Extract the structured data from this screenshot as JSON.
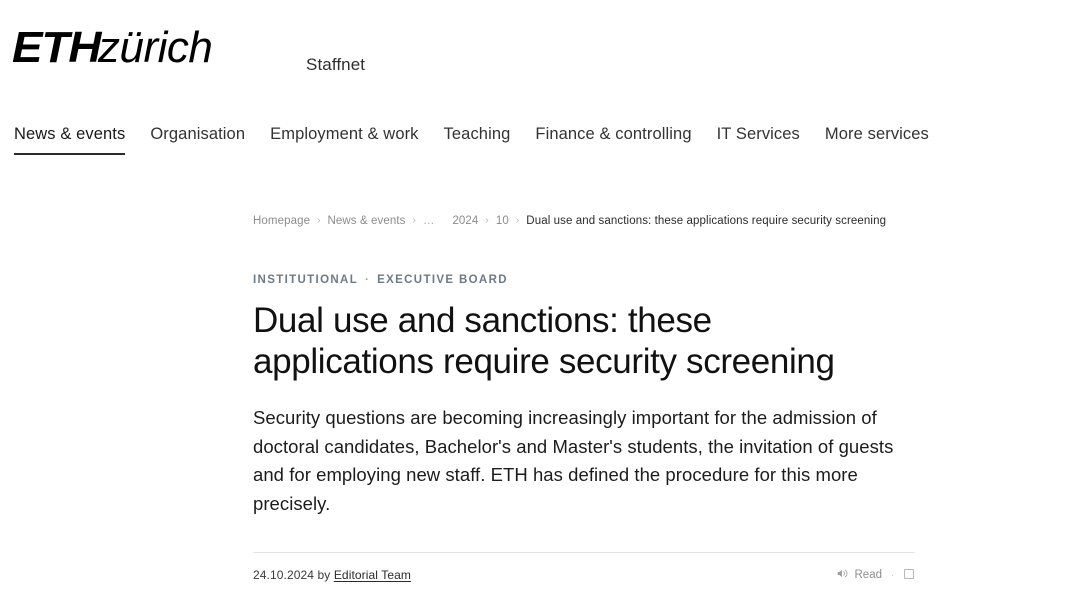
{
  "header": {
    "logo_eth": "ETH",
    "logo_zurich": "zürich",
    "portal_label": "Staffnet"
  },
  "mainnav": {
    "items": [
      {
        "label": "News & events",
        "active": true
      },
      {
        "label": "Organisation",
        "active": false
      },
      {
        "label": "Employment & work",
        "active": false
      },
      {
        "label": "Teaching",
        "active": false
      },
      {
        "label": "Finance & controlling",
        "active": false
      },
      {
        "label": "IT Services",
        "active": false
      },
      {
        "label": "More services",
        "active": false
      }
    ]
  },
  "breadcrumb": {
    "separator": "›",
    "items": [
      {
        "label": "Homepage",
        "current": false,
        "ellipsis": false
      },
      {
        "label": "News & events",
        "current": false,
        "ellipsis": false
      },
      {
        "label": "…",
        "current": false,
        "ellipsis": true
      },
      {
        "label": "2024",
        "current": false,
        "ellipsis": false
      },
      {
        "label": "10",
        "current": false,
        "ellipsis": false
      },
      {
        "label": "Dual use and sanctions: these applications require security screening",
        "current": true,
        "ellipsis": false
      }
    ]
  },
  "article": {
    "kicker_primary": "INSTITUTIONAL",
    "kicker_separator": "·",
    "kicker_secondary": "EXECUTIVE BOARD",
    "headline": "Dual use and sanctions: these applications require security screening",
    "lead": "Security questions are becoming increasingly important for the admission of doctoral candidates, Bachelor's and Master's students, the invitation of guests and for employing new staff. ETH has defined the procedure for this more precisely.",
    "date": "24.10.2024",
    "by_label": "by",
    "author": "Editorial Team",
    "read_label": "Read",
    "tools_separator": "·"
  },
  "colors": {
    "accent_dark": "#2b2b2b",
    "kicker": "#6d7b86",
    "muted": "#8c8c8c",
    "divider": "#e3e3e3"
  }
}
